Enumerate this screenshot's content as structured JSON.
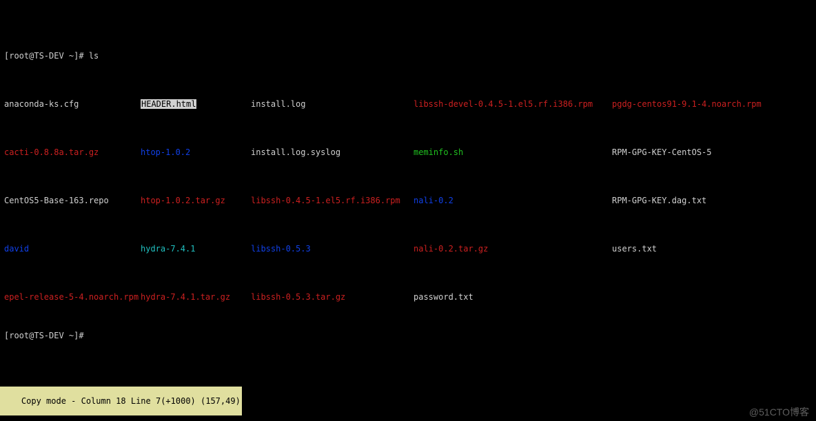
{
  "prompt_line1": "[root@TS-DEV ~]# ls",
  "prompt_line2": "[root@TS-DEV ~]# ",
  "listing": [
    [
      {
        "t": "anaconda-ks.cfg",
        "c": "c-white"
      },
      {
        "t": "HEADER.html",
        "c": "hl"
      },
      {
        "t": "install.log",
        "c": "c-white"
      },
      {
        "t": "libssh-devel-0.4.5-1.el5.rf.i386.rpm",
        "c": "c-red"
      },
      {
        "t": "pgdg-centos91-9.1-4.noarch.rpm",
        "c": "c-red"
      }
    ],
    [
      {
        "t": "cacti-0.8.8a.tar.gz",
        "c": "c-red"
      },
      {
        "t": "htop-1.0.2",
        "c": "c-blue"
      },
      {
        "t": "install.log.syslog",
        "c": "c-white"
      },
      {
        "t": "meminfo.sh",
        "c": "c-green"
      },
      {
        "t": "RPM-GPG-KEY-CentOS-5",
        "c": "c-white"
      }
    ],
    [
      {
        "t": "CentOS5-Base-163.repo",
        "c": "c-white"
      },
      {
        "t": "htop-1.0.2.tar.gz",
        "c": "c-red"
      },
      {
        "t": "libssh-0.4.5-1.el5.rf.i386.rpm",
        "c": "c-red"
      },
      {
        "t": "nali-0.2",
        "c": "c-blue"
      },
      {
        "t": "RPM-GPG-KEY.dag.txt",
        "c": "c-white"
      }
    ],
    [
      {
        "t": "david",
        "c": "c-blue"
      },
      {
        "t": "hydra-7.4.1",
        "c": "c-cyan"
      },
      {
        "t": "libssh-0.5.3",
        "c": "c-blue"
      },
      {
        "t": "nali-0.2.tar.gz",
        "c": "c-red"
      },
      {
        "t": "users.txt",
        "c": "c-white"
      }
    ],
    [
      {
        "t": "epel-release-5-4.noarch.rpm",
        "c": "c-red"
      },
      {
        "t": "hydra-7.4.1.tar.gz",
        "c": "c-red"
      },
      {
        "t": "libssh-0.5.3.tar.gz",
        "c": "c-red"
      },
      {
        "t": "password.txt",
        "c": "c-white"
      },
      {
        "t": "",
        "c": "c-white"
      }
    ]
  ],
  "statusbar": "Copy mode - Column 18 Line 7(+1000) (157,49)",
  "watermark": "@51CTO博客"
}
